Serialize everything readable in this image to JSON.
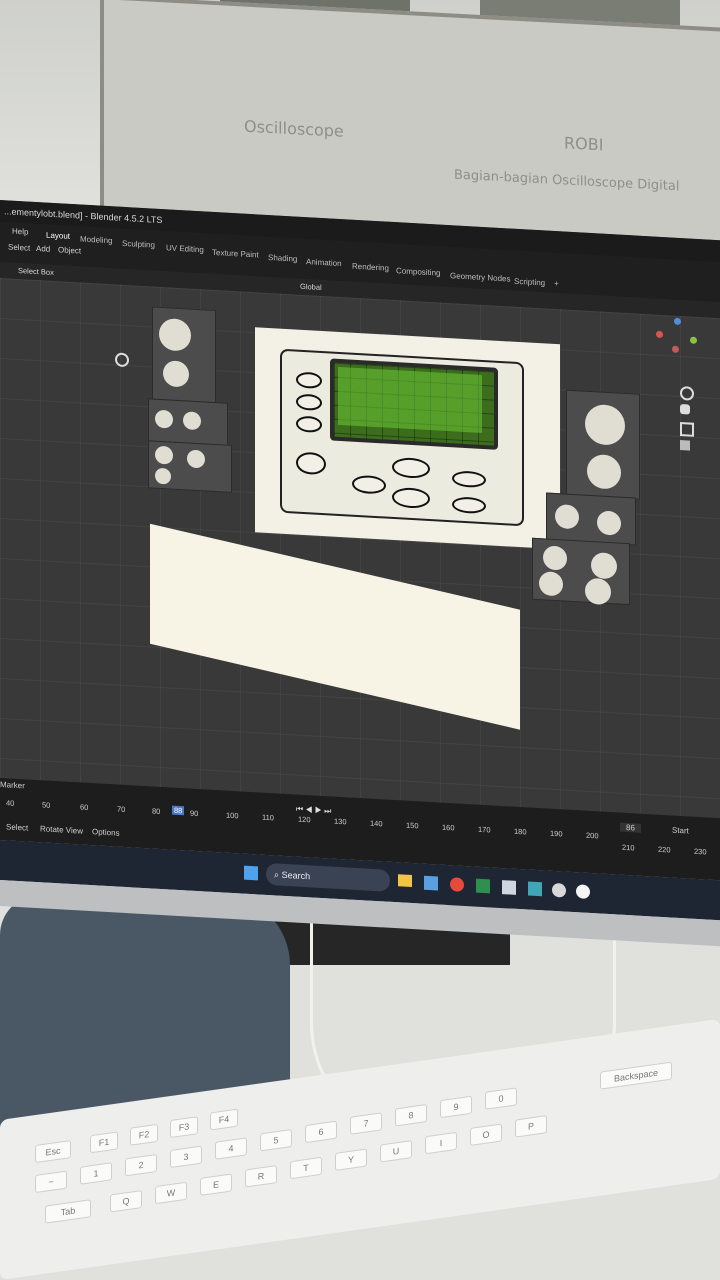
{
  "blender": {
    "window_title": "...ementylobt.blend] - Blender 4.5.2 LTS",
    "menu": [
      "Help",
      "Select",
      "Add",
      "Object"
    ],
    "workspace_tabs": [
      "Layout",
      "Modeling",
      "Sculpting",
      "UV Editing",
      "Texture Paint",
      "Shading",
      "Animation",
      "Rendering",
      "Compositing",
      "Geometry Nodes",
      "Scripting",
      "+"
    ],
    "active_tab": "Layout",
    "header": {
      "select_mode": "Select Box",
      "orientation": "Global"
    },
    "timeline": {
      "marker_label": "Marker",
      "frames": [
        "40",
        "50",
        "60",
        "70",
        "80",
        "88",
        "90",
        "100",
        "110",
        "120",
        "130",
        "140",
        "150",
        "160",
        "170",
        "180",
        "190",
        "200",
        "210",
        "220",
        "230"
      ],
      "current_frame": "88",
      "end_frame_field": "86",
      "start_label": "Start",
      "status": [
        "Select",
        "Rotate View",
        "Options"
      ]
    }
  },
  "taskbar": {
    "search_placeholder": "Search"
  },
  "whiteboard_text": [
    "Oscilloscope",
    "ROBI",
    "Bagian-bagian Oscilloscope Digital"
  ],
  "colors": {
    "scope_screen": "#3b6d1c",
    "viewport": "#393939",
    "taskbar": "#1e2633"
  }
}
